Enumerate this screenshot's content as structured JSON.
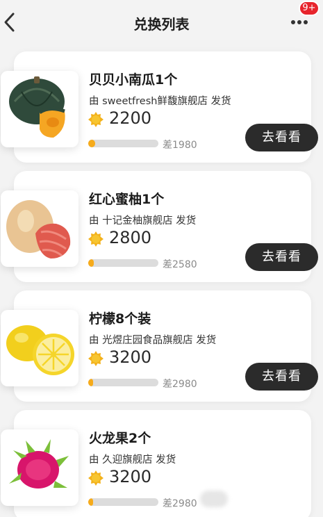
{
  "header": {
    "title": "兑换列表",
    "more_icon": "more-dots-icon",
    "badge": "9+",
    "back_icon": "chevron-left-icon"
  },
  "items": [
    {
      "name": "贝贝小南瓜1个",
      "shipper": "由 sweetfresh鲜馥旗舰店 发货",
      "points": "2200",
      "progress": 0.1,
      "diff": "差1980",
      "button": "去看看",
      "image_icon": "pumpkin-icon"
    },
    {
      "name": "红心蜜柚1个",
      "shipper": "由 十记金柚旗舰店 发货",
      "points": "2800",
      "progress": 0.08,
      "diff": "差2580",
      "button": "去看看",
      "image_icon": "pomelo-icon"
    },
    {
      "name": "柠檬8个装",
      "shipper": "由 光煜庄园食品旗舰店 发货",
      "points": "3200",
      "progress": 0.07,
      "diff": "差2980",
      "button": "去看看",
      "image_icon": "lemon-icon"
    },
    {
      "name": "火龙果2个",
      "shipper": "由 久迎旗舰店 发货",
      "points": "3200",
      "progress": 0.07,
      "diff": "差2980",
      "button": "",
      "image_icon": "dragon-fruit-icon"
    }
  ],
  "colors": {
    "accent": "#f6ab1b",
    "button_bg": "#2b2b2b",
    "badge": "#e7242c"
  }
}
